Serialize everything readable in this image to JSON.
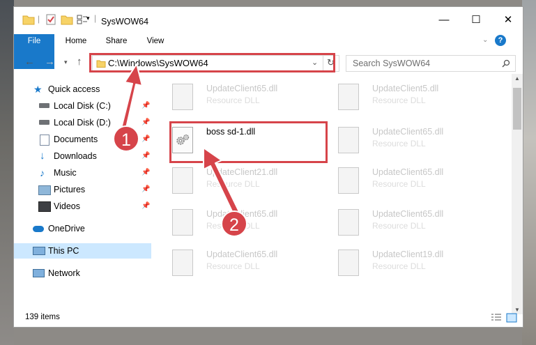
{
  "window": {
    "title": "SysWOW64",
    "controls": {
      "minimize": "—",
      "maximize": "☐",
      "close": "✕"
    }
  },
  "ribbon": {
    "tabs": [
      "File",
      "Home",
      "Share",
      "View"
    ],
    "help_glyph": "?"
  },
  "address_bar": {
    "path": "C:\\Windows\\SysWOW64",
    "search_placeholder": "Search SysWOW64"
  },
  "nav_pane": {
    "items": [
      {
        "label": "Quick access",
        "icon": "star-icon",
        "pinned": false
      },
      {
        "label": "Local Disk (C:)",
        "icon": "drive-icon",
        "pinned": true
      },
      {
        "label": "Local Disk (D:)",
        "icon": "drive-icon",
        "pinned": true
      },
      {
        "label": "Documents",
        "icon": "document-icon",
        "pinned": true
      },
      {
        "label": "Downloads",
        "icon": "download-icon",
        "pinned": true
      },
      {
        "label": "Music",
        "icon": "music-icon",
        "pinned": true
      },
      {
        "label": "Pictures",
        "icon": "picture-icon",
        "pinned": true
      },
      {
        "label": "Videos",
        "icon": "video-icon",
        "pinned": true
      },
      {
        "label": "OneDrive",
        "icon": "cloud-icon",
        "pinned": false
      },
      {
        "label": "This PC",
        "icon": "computer-icon",
        "pinned": false,
        "selected": true
      },
      {
        "label": "Network",
        "icon": "network-icon",
        "pinned": false
      }
    ]
  },
  "files": [
    {
      "name": "UpdateClient65.dll",
      "desc": "Resource DLL"
    },
    {
      "name": "UpdateClient5.dll",
      "desc": "Resource DLL"
    },
    {
      "name": "boss sd-1.dll",
      "desc": "",
      "active": true
    },
    {
      "name": "UpdateClient65.dll",
      "desc": "Resource DLL"
    },
    {
      "name": "UpdateClient21.dll",
      "desc": "Resource DLL"
    },
    {
      "name": "UpdateClient65.dll",
      "desc": "Resource DLL"
    },
    {
      "name": "UpdateClient65.dll",
      "desc": "Resource DLL"
    },
    {
      "name": "UpdateClient65.dll",
      "desc": "Resource DLL"
    },
    {
      "name": "UpdateClient65.dll",
      "desc": "Resource DLL"
    },
    {
      "name": "UpdateClient19.dll",
      "desc": "Resource DLL"
    }
  ],
  "status": {
    "item_count": "139 items"
  },
  "annotations": {
    "marker1": "1",
    "marker2": "2",
    "color": "#d6444a"
  }
}
